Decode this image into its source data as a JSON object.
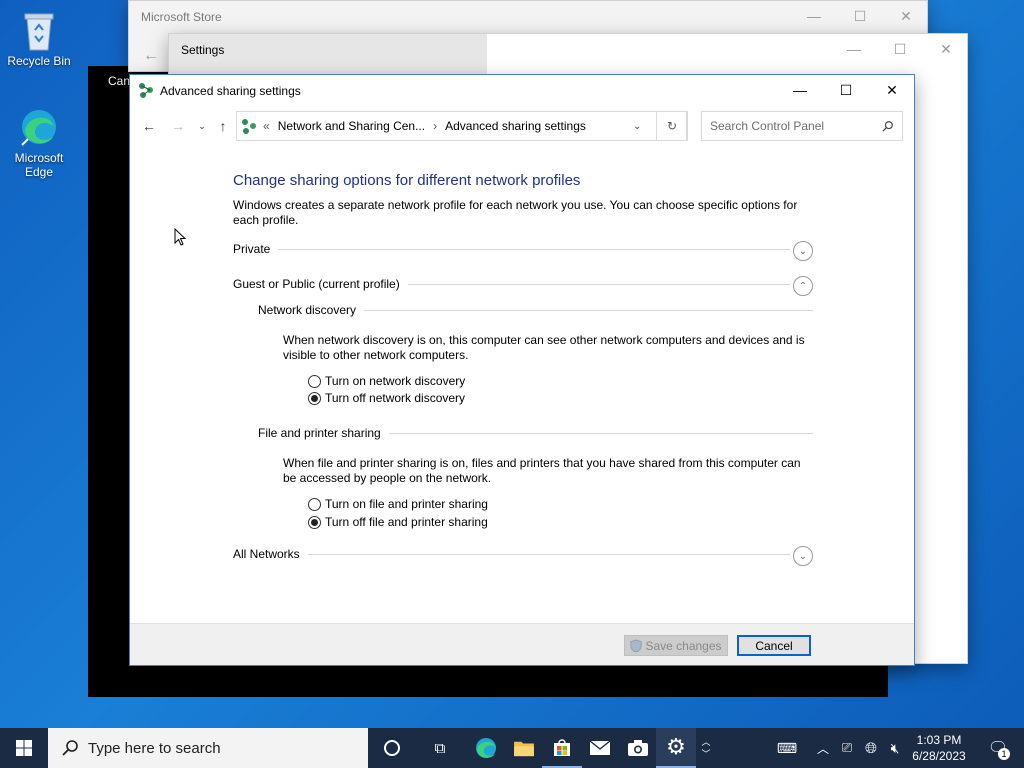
{
  "desktop": {
    "icons": [
      {
        "label": "Recycle Bin",
        "icon": "recycle-bin-icon"
      },
      {
        "label": "Microsoft Edge",
        "icon": "edge-icon"
      }
    ],
    "black_window_label": "Can"
  },
  "store_window": {
    "title": "Microsoft Store"
  },
  "settings_window": {
    "title": "Settings"
  },
  "dialog": {
    "title": "Advanced sharing settings",
    "address": {
      "chevrons": "«",
      "crumb1": "Network and Sharing Cen...",
      "sep": "›",
      "crumb2": "Advanced sharing settings"
    },
    "search_placeholder": "Search Control Panel",
    "heading": "Change sharing options for different network profiles",
    "intro": "Windows creates a separate network profile for each network you use. You can choose specific options for each profile.",
    "sections": {
      "private": "Private",
      "guest": "Guest or Public (current profile)",
      "network_discovery": {
        "title": "Network discovery",
        "desc": "When network discovery is on, this computer can see other network computers and devices and is visible to other network computers.",
        "on": "Turn on network discovery",
        "off": "Turn off network discovery",
        "selected": "off"
      },
      "file_sharing": {
        "title": "File and printer sharing",
        "desc": "When file and printer sharing is on, files and printers that you have shared from this computer can be accessed by people on the network.",
        "on": "Turn on file and printer sharing",
        "off": "Turn off file and printer sharing",
        "selected": "off"
      },
      "all_networks": "All Networks"
    },
    "buttons": {
      "save": "Save changes",
      "cancel": "Cancel"
    }
  },
  "taskbar": {
    "search_placeholder": "Type here to search",
    "time": "1:03 PM",
    "date": "6/28/2023",
    "notification_count": "1"
  },
  "colors": {
    "accent": "#0a64c8",
    "heading": "#1e3287",
    "taskbar": "#1c2b44"
  }
}
